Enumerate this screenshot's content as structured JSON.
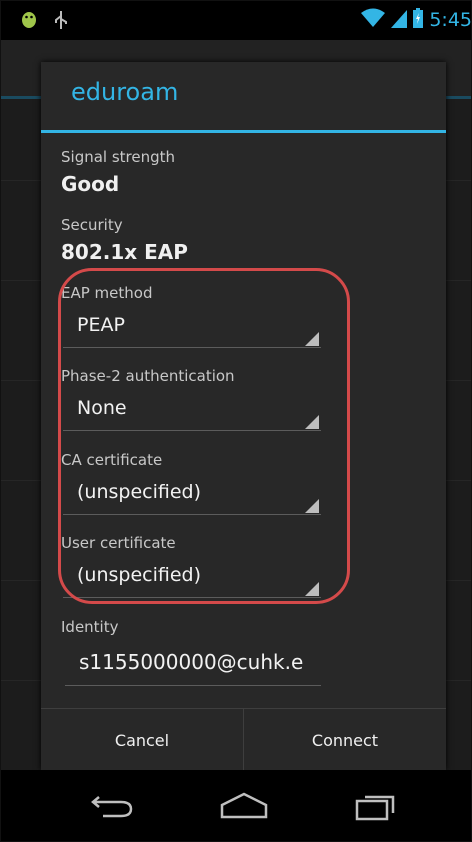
{
  "status_bar": {
    "time": "5:45",
    "left_icons": [
      "android-icon",
      "usb-icon"
    ],
    "right_icons": [
      "wifi-icon",
      "signal-icon",
      "battery-icon"
    ]
  },
  "dialog": {
    "title": "eduroam",
    "signal_label": "Signal strength",
    "signal_value": "Good",
    "security_label": "Security",
    "security_value": "802.1x EAP",
    "eap_method": {
      "label": "EAP method",
      "value": "PEAP"
    },
    "phase2": {
      "label": "Phase-2 authentication",
      "value": "None"
    },
    "ca_cert": {
      "label": "CA certificate",
      "value": "(unspecified)"
    },
    "user_cert": {
      "label": "User certificate",
      "value": "(unspecified)"
    },
    "identity": {
      "label": "Identity",
      "value": "s1155000000@cuhk.e"
    },
    "cancel_label": "Cancel",
    "connect_label": "Connect"
  },
  "nav_bar": {
    "icons": [
      "back-icon",
      "home-icon",
      "recent-apps-icon"
    ]
  },
  "colors": {
    "accent": "#33b5e5",
    "highlight": "#d44a4a",
    "dialog_bg": "#282828"
  }
}
